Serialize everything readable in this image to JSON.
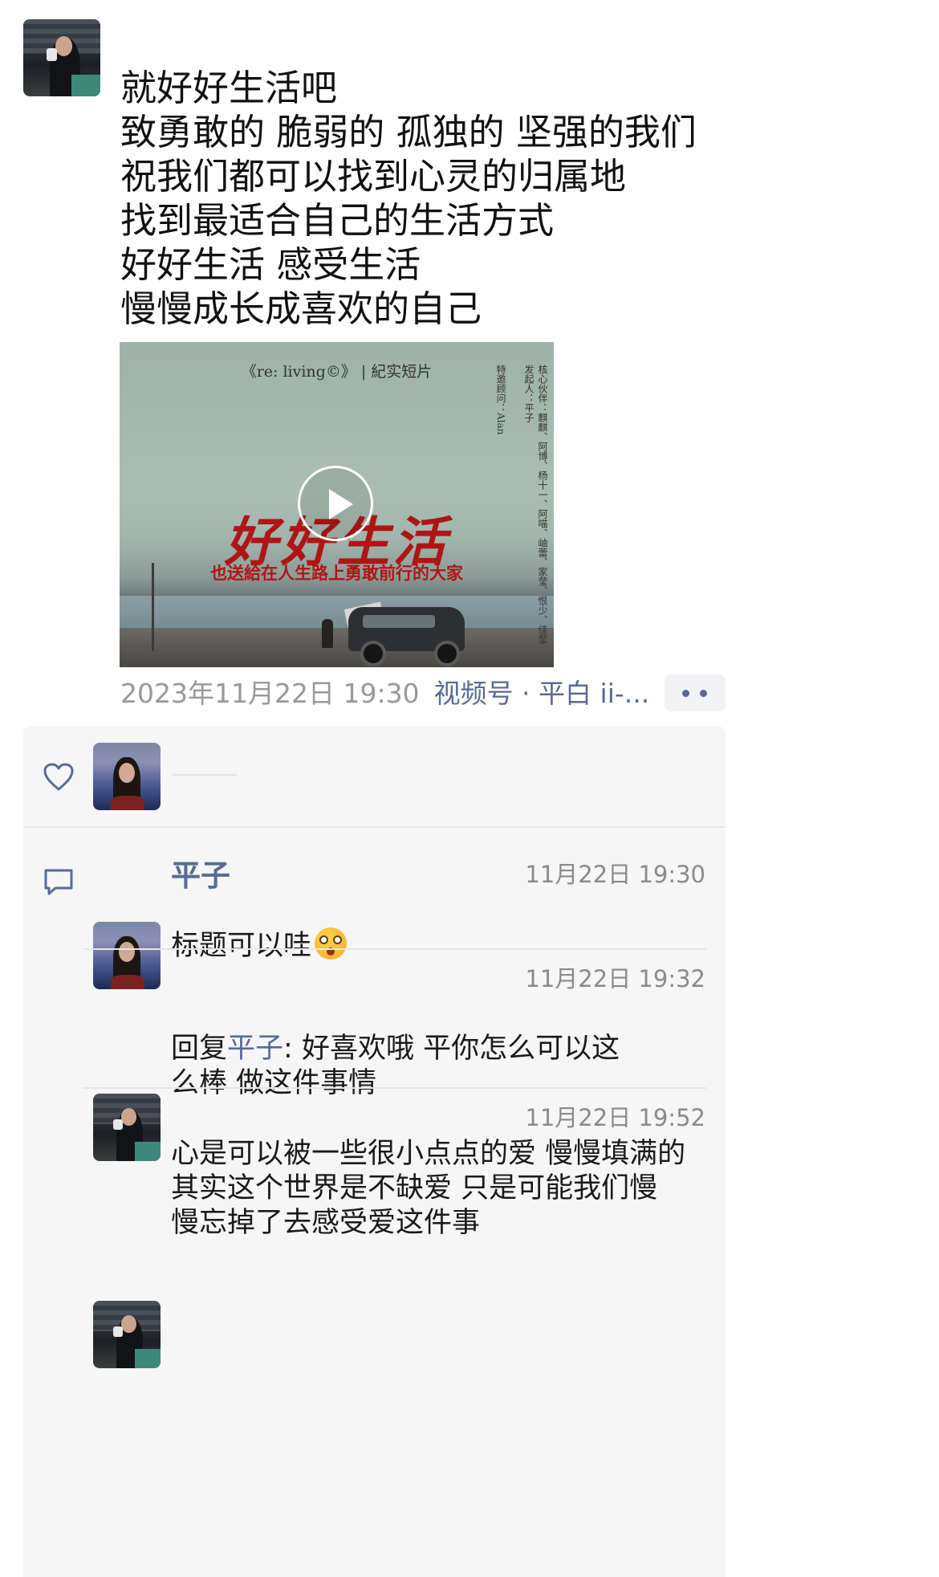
{
  "post": {
    "lines": "就好好生活吧\n致勇敢的 脆弱的 孤独的 坚强的我们\n祝我们都可以找到心灵的归属地\n找到最适合自己的生活方式\n好好生活 感受生活\n慢慢成长成喜欢的自己",
    "video": {
      "top_caption": "《re: living©》 | 紀实短片",
      "title": "好好生活",
      "subtitle": "也送給在人生路上勇敢前行的大家",
      "credits_1": "核心伙伴：麒麒、阿博、杨十一、阿喵、岫蕾、家莹、恨少、佳莹",
      "credits_2": "发起人：平子",
      "credits_3": "特邀顾问：Alan"
    },
    "meta": {
      "time": "2023年11月22日 19:30",
      "source": "视频号 · 平白 ii-..."
    }
  },
  "comments": [
    {
      "name": "平子",
      "time": "11月22日 19:30",
      "text": "标题可以哇"
    },
    {
      "time": "11月22日 19:32",
      "reply_prefix": "回复",
      "reply_to": "平子",
      "reply_body": ": 好喜欢哦        平你怎么可以这\n么棒 做这件事情"
    },
    {
      "time": "11月22日 19:52",
      "text": "心是可以被一些很小点点的爱 慢慢填满的\n 其实这个世界是不缺爱 只是可能我们慢\n慢忘掉了去感受爱这件事"
    }
  ],
  "icons": {
    "like": "heart-icon",
    "comment": "comment-icon",
    "more": "more-icon"
  },
  "colors": {
    "link": "#576b95",
    "meta": "#999999",
    "panel": "#f6f6f6"
  }
}
